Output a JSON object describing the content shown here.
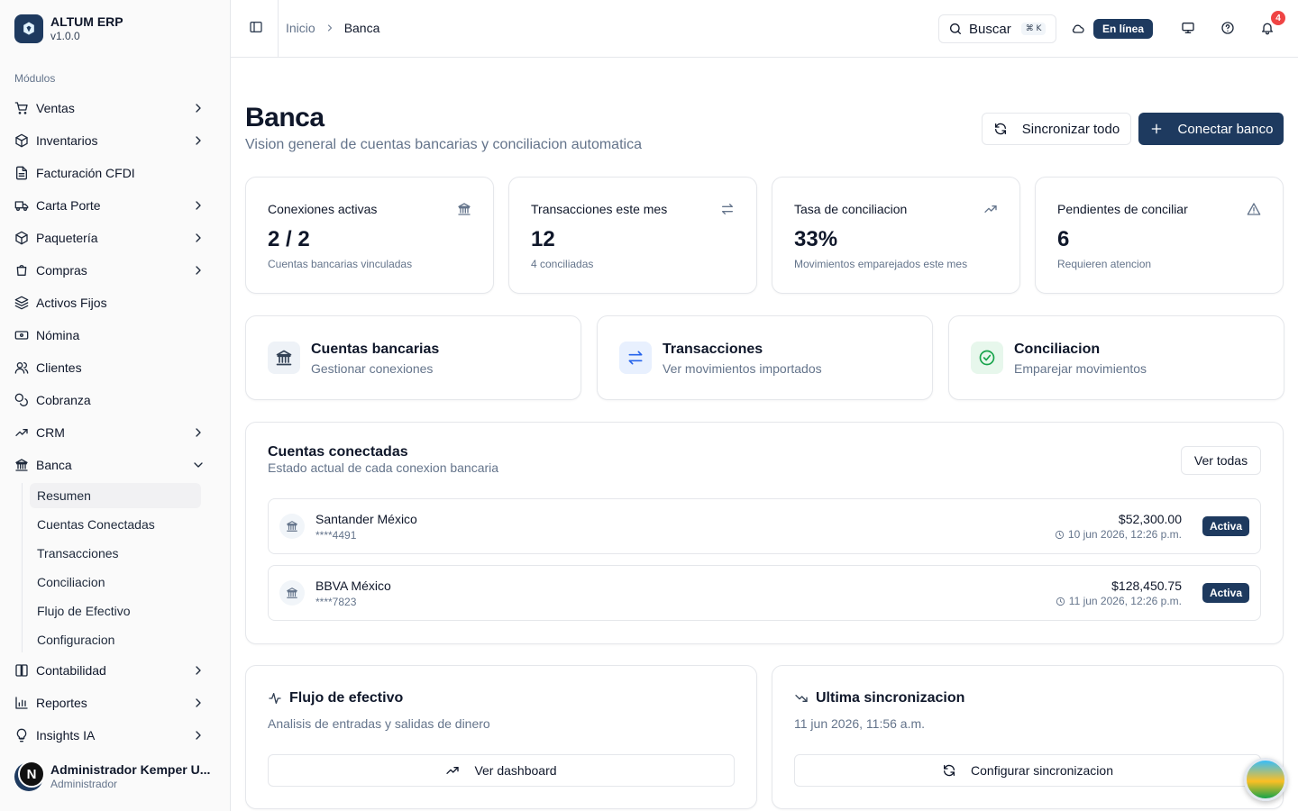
{
  "app": {
    "name": "ALTUM ERP",
    "version": "v1.0.0"
  },
  "sidebar": {
    "section_label": "Módulos",
    "items": [
      {
        "label": "Ventas",
        "icon": "cart-icon",
        "expandable": true
      },
      {
        "label": "Inventarios",
        "icon": "package-icon",
        "expandable": true
      },
      {
        "label": "Facturación CFDI",
        "icon": "file-text-icon",
        "expandable": false
      },
      {
        "label": "Carta Porte",
        "icon": "truck-icon",
        "expandable": true
      },
      {
        "label": "Paquetería",
        "icon": "package-icon",
        "expandable": true
      },
      {
        "label": "Compras",
        "icon": "shopping-bag-icon",
        "expandable": true
      },
      {
        "label": "Activos Fijos",
        "icon": "layers-icon",
        "expandable": false
      },
      {
        "label": "Nómina",
        "icon": "banknote-icon",
        "expandable": false
      },
      {
        "label": "Clientes",
        "icon": "users-icon",
        "expandable": false
      },
      {
        "label": "Cobranza",
        "icon": "coins-icon",
        "expandable": false
      },
      {
        "label": "CRM",
        "icon": "trending-up-icon",
        "expandable": true
      },
      {
        "label": "Banca",
        "icon": "bank-icon",
        "expandable": true,
        "expanded": true
      },
      {
        "label": "Contabilidad",
        "icon": "book-icon",
        "expandable": true
      },
      {
        "label": "Reportes",
        "icon": "bar-chart-icon",
        "expandable": true
      },
      {
        "label": "Insights IA",
        "icon": "lightbulb-icon",
        "expandable": true
      }
    ],
    "banca_sub": [
      "Resumen",
      "Cuentas Conectadas",
      "Transacciones",
      "Conciliacion",
      "Flujo de Efectivo",
      "Configuracion"
    ],
    "active_sub": "Resumen",
    "user": {
      "initial": "N",
      "name": "Administrador Kemper U...",
      "role": "Administrador"
    }
  },
  "topbar": {
    "breadcrumb": [
      "Inicio",
      "Banca"
    ],
    "search_label": "Buscar",
    "search_shortcut": "⌘ K",
    "status_label": "En línea",
    "notifications_count": "4"
  },
  "page": {
    "title": "Banca",
    "subtitle": "Vision general de cuentas bancarias y conciliacion automatica",
    "sync_all_label": "Sincronizar todo",
    "connect_bank_label": "Conectar banco"
  },
  "stats": [
    {
      "label": "Conexiones activas",
      "value": "2 / 2",
      "note": "Cuentas bancarias vinculadas",
      "icon": "bank-icon"
    },
    {
      "label": "Transacciones este mes",
      "value": "12",
      "note": "4 conciliadas",
      "icon": "arrows-exchange-icon"
    },
    {
      "label": "Tasa de conciliacion",
      "value": "33%",
      "note": "Movimientos emparejados este mes",
      "icon": "trending-up-icon"
    },
    {
      "label": "Pendientes de conciliar",
      "value": "6",
      "note": "Requieren atencion",
      "icon": "warning-icon"
    }
  ],
  "quick_actions": [
    {
      "title": "Cuentas bancarias",
      "subtitle": "Gestionar conexiones",
      "icon": "bank-icon",
      "color": "#334155",
      "bg": "#eef2f7"
    },
    {
      "title": "Transacciones",
      "subtitle": "Ver movimientos importados",
      "icon": "arrows-exchange-icon",
      "color": "#2563eb",
      "bg": "#e8f0fe"
    },
    {
      "title": "Conciliacion",
      "subtitle": "Emparejar movimientos",
      "icon": "check-circle-icon",
      "color": "#16a34a",
      "bg": "#e7f7ec"
    }
  ],
  "connected": {
    "title": "Cuentas conectadas",
    "subtitle": "Estado actual de cada conexion bancaria",
    "view_all_label": "Ver todas",
    "accounts": [
      {
        "name": "Santander México",
        "number": "****4491",
        "balance": "$52,300.00",
        "date": "10 jun 2026, 12:26 p.m.",
        "status": "Activa"
      },
      {
        "name": "BBVA México",
        "number": "****7823",
        "balance": "$128,450.75",
        "date": "11 jun 2026, 12:26 p.m.",
        "status": "Activa"
      }
    ]
  },
  "cashflow": {
    "title": "Flujo de efectivo",
    "subtitle": "Analisis de entradas y salidas de dinero",
    "button_label": "Ver dashboard"
  },
  "last_sync": {
    "title": "Ultima sincronizacion",
    "value": "11 jun 2026, 11:56 a.m.",
    "button_label": "Configurar sincronizacion"
  },
  "colors": {
    "primary": "#1e3a5f",
    "danger": "#ef4444",
    "muted": "#64748b",
    "border": "#e5e7eb"
  }
}
